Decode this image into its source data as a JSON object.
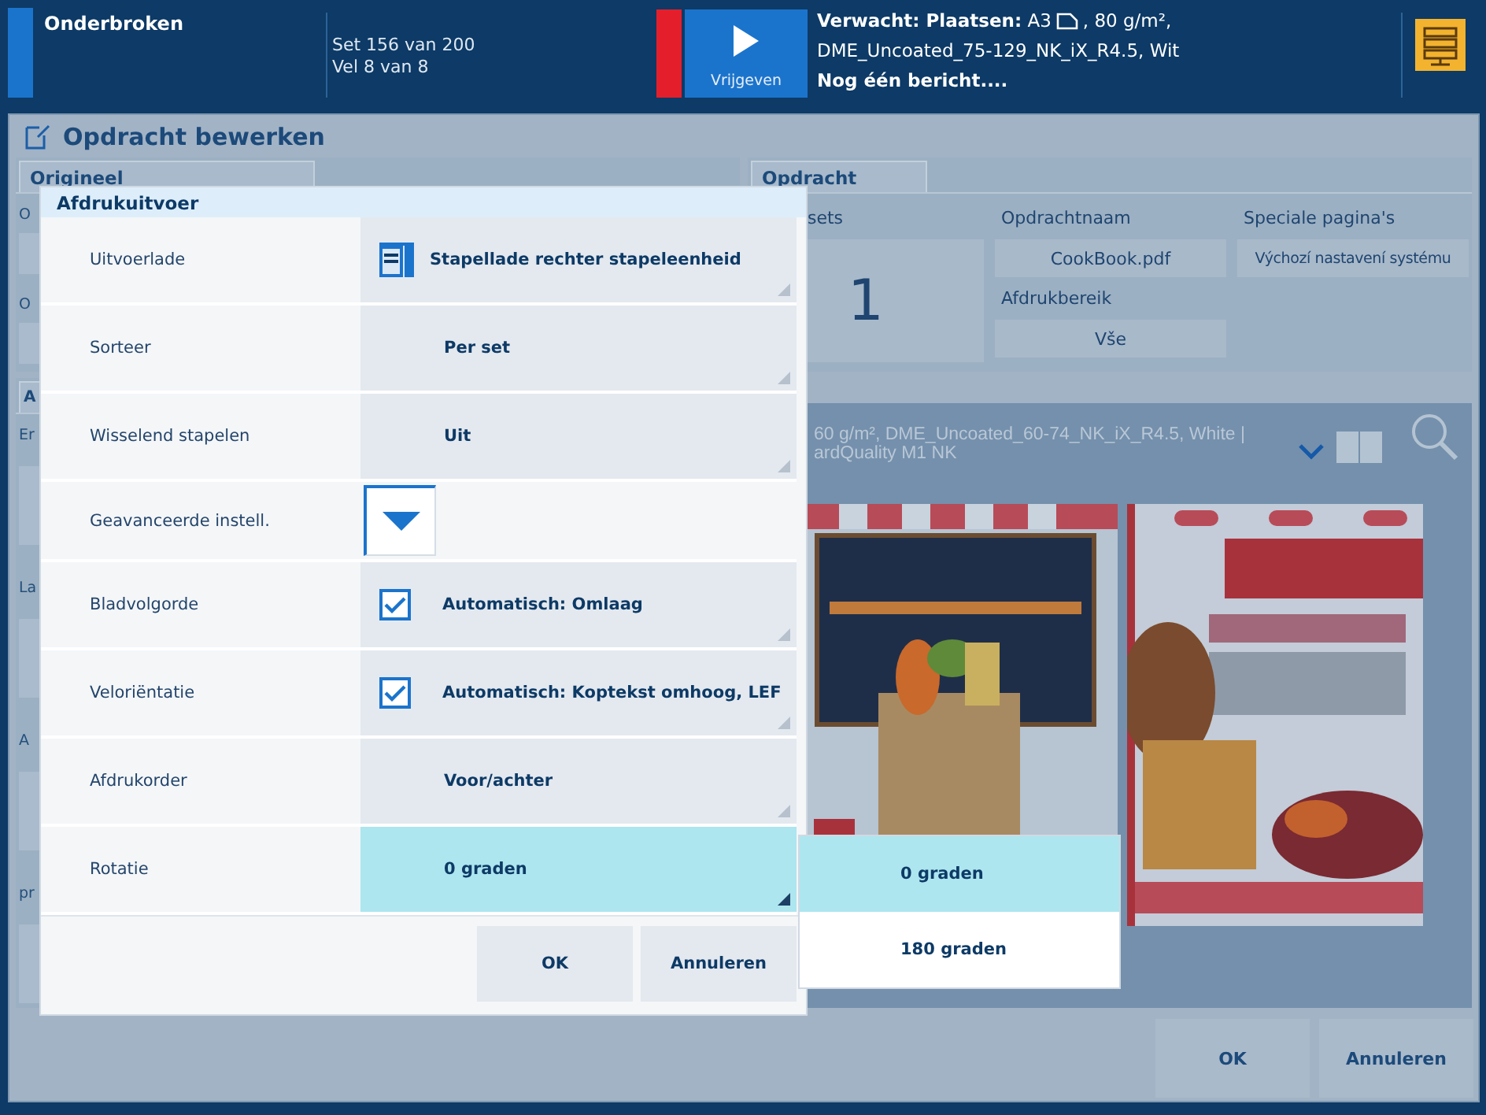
{
  "top_bar": {
    "status": "Onderbroken",
    "set_progress": "Set 156 van 200",
    "sheet_progress": "Vel 8 van 8",
    "release_button": "Vrijgeven",
    "message_line_1a": "**Verwacht: Plaatsen:** A3",
    "message_line_1b": ", 80 g/m²,",
    "message_line_2": "DME_Uncoated_75-129_NK_iX_R4.5, Wit",
    "message_line_3": "Nog één bericht...."
  },
  "window": {
    "title": "Opdracht bewerken"
  },
  "original_panel": {
    "tab": "Origineel",
    "fragments": [
      "O",
      "O"
    ]
  },
  "attributes_panel": {
    "tab": "A",
    "fragments": [
      "Er",
      "La",
      "A",
      "pr"
    ]
  },
  "job_panel": {
    "tab": "Opdracht",
    "sets_label": "sets",
    "sets_value": "1",
    "name_label": "Opdrachtnaam",
    "name_value": "CookBook.pdf",
    "range_label": "Afdrukbereik",
    "range_value": "Vše",
    "special_label": "Speciale pagina's",
    "special_value": "Výchozí nastavení systému"
  },
  "preview": {
    "media_line_1": "60 g/m², DME_Uncoated_60-74_NK_iX_R4.5, White |",
    "media_line_2": "ardQuality M1 NK"
  },
  "buttons": [
    "OK",
    "Annuleren"
  ],
  "dialog": {
    "title": "Afdrukuitvoer",
    "rows": [
      {
        "label": "Uitvoerlade",
        "kind": "iconselect",
        "value": "Stapellade rechter stapeleenheid",
        "open": false
      },
      {
        "label": "Sorteer",
        "kind": "select",
        "value": "Per set",
        "open": false
      },
      {
        "label": "Wisselend stapelen",
        "kind": "select",
        "value": "Uit",
        "open": false
      },
      {
        "label": "Geavanceerde instell.",
        "kind": "expander",
        "expanded": false
      },
      {
        "label": "Bladvolgorde",
        "kind": "checkselect",
        "checked": true,
        "value": "Automatisch: Omlaag",
        "open": false
      },
      {
        "label": "Veloriëntatie",
        "kind": "checkselect",
        "checked": true,
        "value": "Automatisch: Koptekst omhoog, LEF",
        "open": false
      },
      {
        "label": "Afdrukorder",
        "kind": "select",
        "value": "Voor/achter",
        "open": false
      },
      {
        "label": "Rotatie",
        "kind": "select",
        "value": "0 graden",
        "open": true
      }
    ],
    "buttons": [
      "OK",
      "Annuleren"
    ]
  },
  "dropdown": {
    "options": [
      {
        "label": "0 graden",
        "selected": true
      },
      {
        "label": "180 graden",
        "selected": false
      }
    ]
  }
}
